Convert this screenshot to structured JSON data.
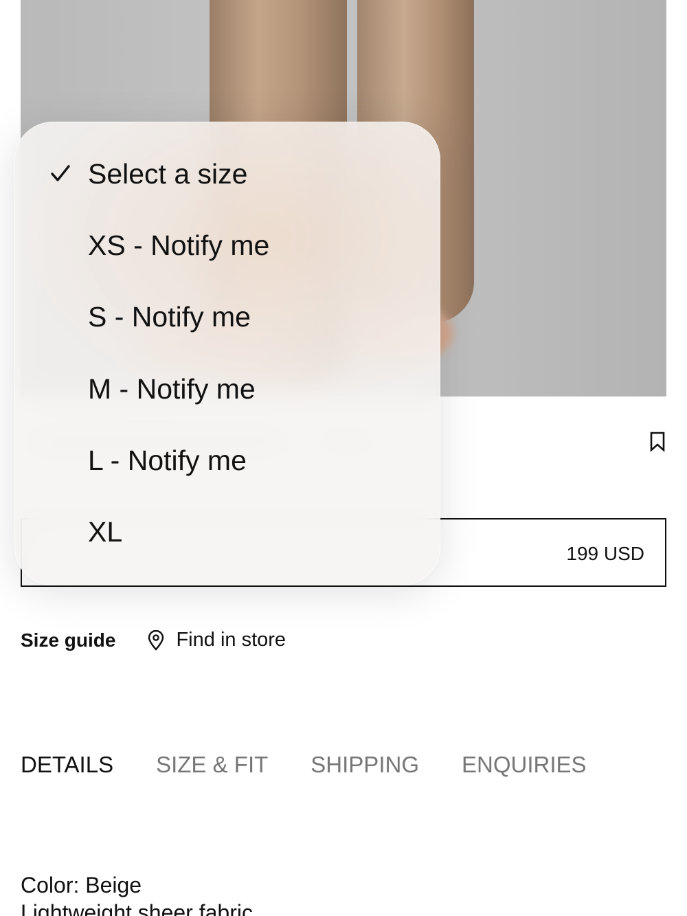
{
  "product": {
    "price": "199 USD"
  },
  "size_menu": {
    "options": [
      {
        "label": "Select a size",
        "selected": true
      },
      {
        "label": "XS - Notify me",
        "selected": false
      },
      {
        "label": "S - Notify me",
        "selected": false
      },
      {
        "label": "M - Notify me",
        "selected": false
      },
      {
        "label": "L - Notify me",
        "selected": false
      },
      {
        "label": "XL",
        "selected": false
      }
    ]
  },
  "links": {
    "size_guide": "Size guide",
    "find_in_store": "Find in store"
  },
  "tabs": [
    {
      "label": "DETAILS",
      "active": true
    },
    {
      "label": "SIZE & FIT",
      "active": false
    },
    {
      "label": "SHIPPING",
      "active": false
    },
    {
      "label": "ENQUIRIES",
      "active": false
    }
  ],
  "details": {
    "color_line": "Color: Beige",
    "line2": "Lightweight sheer fabric"
  },
  "icons": {
    "check": "check-icon",
    "bookmark": "bookmark-icon",
    "pin": "location-pin-icon"
  },
  "colors": {
    "text": "#111111",
    "inactive_tab": "#777777",
    "popover_bg": "#f6f4f3"
  }
}
